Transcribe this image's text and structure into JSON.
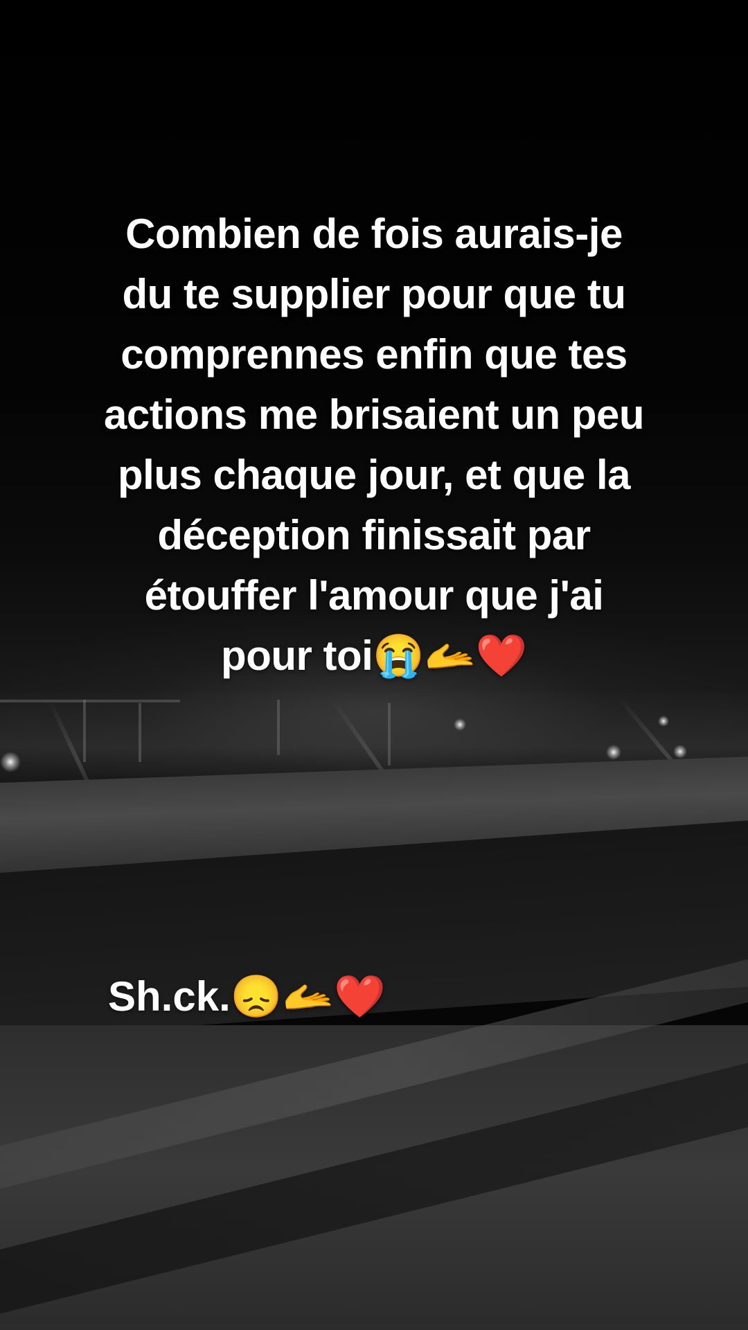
{
  "caption": {
    "text": "Combien de fois aurais-je\ndu te supplier pour que tu\ncomprennes enfin que tes\nactions me brisaient un peu\nplus chaque jour, et que la\ndéception finissait par\nétouffer l'amour que j'ai\npour toi😭🫴❤️"
  },
  "signature": {
    "text": "Sh.ck.😞🫴❤️"
  },
  "background": {
    "description_icon": "night-road-photo",
    "palette": {
      "sky": "#000000",
      "road": "#333333",
      "text": "#ffffff"
    }
  }
}
